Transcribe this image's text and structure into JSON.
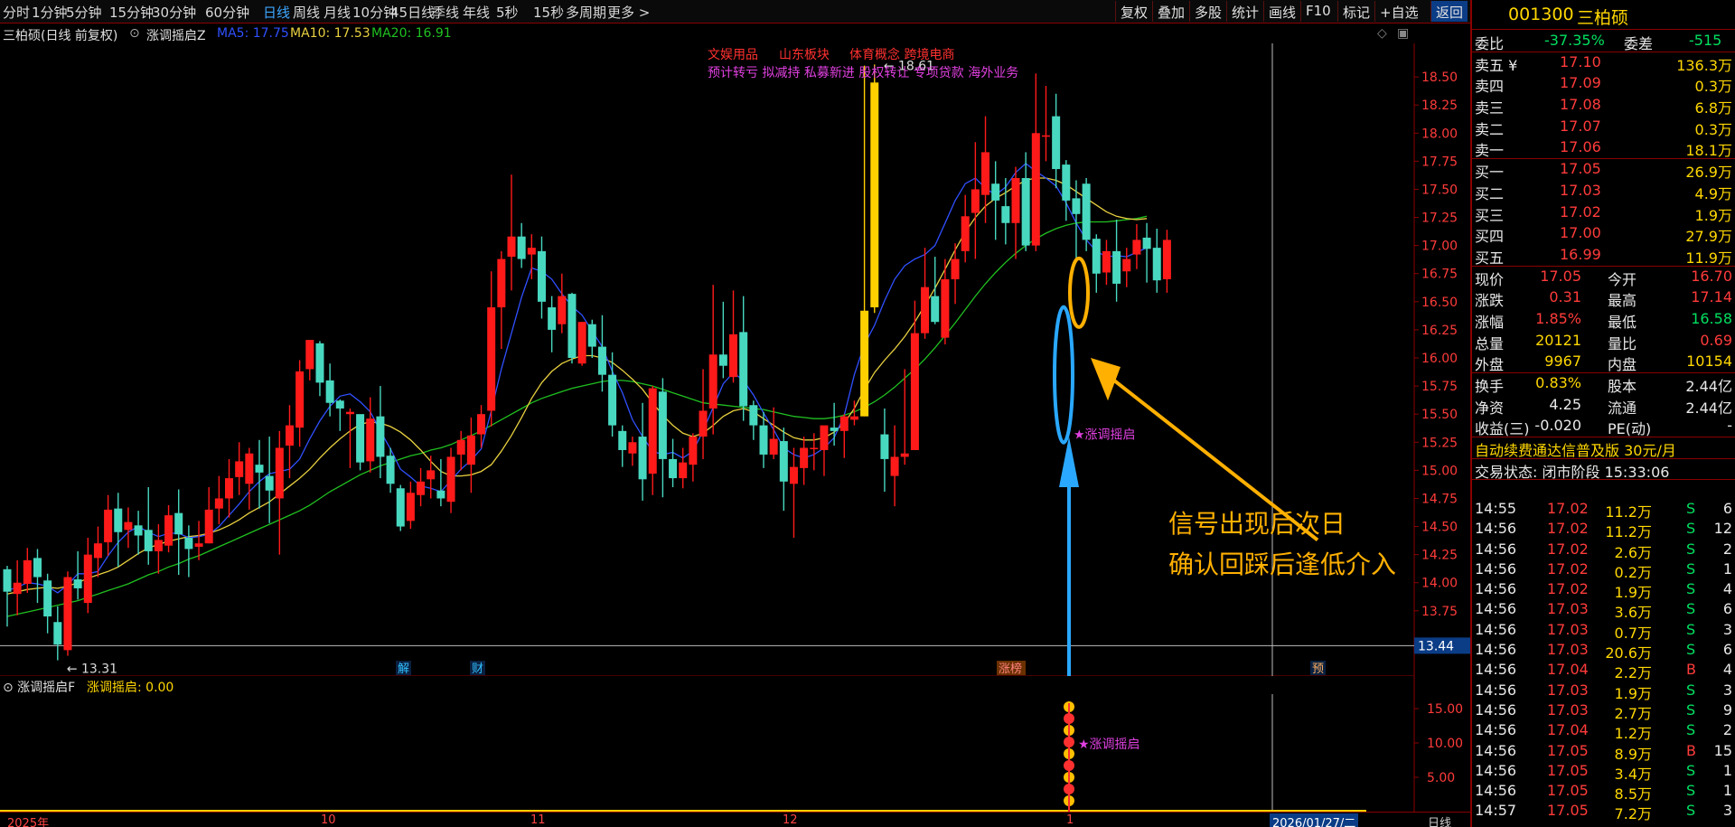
{
  "periods": [
    "分时",
    "1分钟",
    "5分钟",
    "15分钟",
    "30分钟",
    "60分钟",
    "日线",
    "周线",
    "月线",
    "10分钟",
    "45日线",
    "季线",
    "年线",
    "5秒",
    "15秒",
    "多周期",
    "更多 >"
  ],
  "active_period": "日线",
  "right_buttons": [
    "复权",
    "叠加",
    "多股",
    "统计",
    "画线",
    "F10",
    "标记",
    "+自选",
    "返回"
  ],
  "stock": {
    "code": "001300",
    "name": "三柏硕"
  },
  "info": {
    "title": "三柏硕(日线 前复权)",
    "indicator": "涨调摇启Z",
    "ma5": "MA5: 17.75",
    "ma10": "MA10: 17.53",
    "ma20": "MA20: 16.91"
  },
  "concepts": {
    "line1": [
      "文娱用品",
      "山东板块",
      "体育概念 跨境电商"
    ],
    "line2": "预计转亏 拟减持 私募新进 股权转让 专项贷款 海外业务"
  },
  "annotation": {
    "signal_label": "★涨调摇启",
    "note_line1": "信号出现后次日",
    "note_line2": "确认回踩后逢低介入",
    "max_label": "18.61",
    "min_label": "13.31",
    "crosshair_price": "13.44"
  },
  "event_markers": [
    "解",
    "财",
    "涨榜",
    "预"
  ],
  "sub": {
    "title": "涨调摇启F",
    "value": "涨调摇启: 0.00",
    "ticks": [
      "15.00",
      "10.00",
      "5.00"
    ],
    "signal": "★涨调摇启"
  },
  "x_labels": [
    "2025年",
    "10",
    "11",
    "12",
    "1",
    "2026/01/27/二",
    "日线"
  ],
  "quote": {
    "webi": {
      "label": "委比",
      "value": "-37.35%",
      "label2": "委差",
      "value2": "-515"
    },
    "asks": [
      [
        "卖五 ¥",
        "17.10",
        "136.3万"
      ],
      [
        "卖四",
        "17.09",
        "0.3万"
      ],
      [
        "卖三",
        "17.08",
        "6.8万"
      ],
      [
        "卖二",
        "17.07",
        "0.3万"
      ],
      [
        "卖一",
        "17.06",
        "18.1万"
      ]
    ],
    "bids": [
      [
        "买一",
        "17.05",
        "26.9万"
      ],
      [
        "买二",
        "17.03",
        "4.9万"
      ],
      [
        "买三",
        "17.02",
        "1.9万"
      ],
      [
        "买四",
        "17.00",
        "27.9万"
      ],
      [
        "买五",
        "16.99",
        "11.9万"
      ]
    ],
    "stats": [
      [
        "现价",
        "17.05",
        "今开",
        "16.70"
      ],
      [
        "涨跌",
        "0.31",
        "最高",
        "17.14"
      ],
      [
        "涨幅",
        "1.85%",
        "最低",
        "16.58"
      ],
      [
        "总量",
        "20121",
        "量比",
        "0.69"
      ],
      [
        "外盘",
        "9967",
        "内盘",
        "10154"
      ]
    ],
    "stats2": [
      [
        "换手",
        "0.83%",
        "股本",
        "2.44亿"
      ],
      [
        "净资",
        "4.25",
        "流通",
        "2.44亿"
      ],
      [
        "收益(三)",
        "-0.020",
        "PE(动)",
        "-"
      ]
    ],
    "promo": "自动续费通达信普及版  30元/月",
    "status": "交易状态: 闭市阶段 15:33:06"
  },
  "ticks": [
    [
      "14:55",
      "17.02",
      "11.2万",
      "S",
      "6"
    ],
    [
      "14:56",
      "17.02",
      "11.2万",
      "S",
      "12"
    ],
    [
      "14:56",
      "17.02",
      "2.6万",
      "S",
      "2"
    ],
    [
      "14:56",
      "17.02",
      "0.2万",
      "S",
      "1"
    ],
    [
      "14:56",
      "17.02",
      "1.9万",
      "S",
      "4"
    ],
    [
      "14:56",
      "17.03",
      "3.6万",
      "S",
      "6"
    ],
    [
      "14:56",
      "17.03",
      "0.7万",
      "S",
      "3"
    ],
    [
      "14:56",
      "17.03",
      "20.6万",
      "S",
      "6"
    ],
    [
      "14:56",
      "17.04",
      "2.2万",
      "B",
      "4"
    ],
    [
      "14:56",
      "17.03",
      "1.9万",
      "S",
      "3"
    ],
    [
      "14:56",
      "17.03",
      "2.7万",
      "S",
      "9"
    ],
    [
      "14:56",
      "17.04",
      "1.2万",
      "S",
      "2"
    ],
    [
      "14:56",
      "17.05",
      "8.9万",
      "B",
      "15"
    ],
    [
      "14:56",
      "17.05",
      "3.4万",
      "S",
      "1"
    ],
    [
      "14:56",
      "17.05",
      "8.5万",
      "S",
      "1"
    ],
    [
      "14:57",
      "17.05",
      "7.2万",
      "S",
      "3"
    ]
  ],
  "chart_data": {
    "type": "candlestick",
    "title": "三柏硕(日线 前复权)",
    "ylim": [
      13.25,
      18.75
    ],
    "y_ticks": [
      18.5,
      18.25,
      18.0,
      17.75,
      17.5,
      17.25,
      17.0,
      16.75,
      16.5,
      16.25,
      16.0,
      15.75,
      15.5,
      15.25,
      15.0,
      14.75,
      14.5,
      14.25,
      14.0,
      13.75
    ],
    "colors": {
      "up": "#ff1a1a",
      "down": "#48d8c0",
      "ma5": "#3050ff",
      "ma10": "#e8d040",
      "ma20": "#20c020"
    },
    "ohlc": [
      [
        14.12,
        14.15,
        13.92,
        13.61
      ],
      [
        13.9,
        14.2,
        14.0,
        13.71
      ],
      [
        13.99,
        14.31,
        14.2,
        13.91
      ],
      [
        14.22,
        14.3,
        14.05,
        13.82
      ],
      [
        14.02,
        14.08,
        13.7,
        13.55
      ],
      [
        13.65,
        13.79,
        13.45,
        13.31
      ],
      [
        13.4,
        14.1,
        14.05,
        13.35
      ],
      [
        14.03,
        14.28,
        13.95,
        13.85
      ],
      [
        13.82,
        14.4,
        14.25,
        13.73
      ],
      [
        14.22,
        14.5,
        14.35,
        14.05
      ],
      [
        14.36,
        14.78,
        14.65,
        14.24
      ],
      [
        14.66,
        14.8,
        14.45,
        14.14
      ],
      [
        14.47,
        14.67,
        14.54,
        14.31
      ],
      [
        14.51,
        14.64,
        14.42,
        14.25
      ],
      [
        14.47,
        14.85,
        14.28,
        14.16
      ],
      [
        14.28,
        14.52,
        14.38,
        14.08
      ],
      [
        14.33,
        14.69,
        14.6,
        14.27
      ],
      [
        14.62,
        14.83,
        14.43,
        14.07
      ],
      [
        14.4,
        14.51,
        14.3,
        14.05
      ],
      [
        14.32,
        14.55,
        14.35,
        14.2
      ],
      [
        14.35,
        14.85,
        14.65,
        14.35
      ],
      [
        14.66,
        14.95,
        14.75,
        14.52
      ],
      [
        14.75,
        15.1,
        14.93,
        14.58
      ],
      [
        14.94,
        15.25,
        15.08,
        14.78
      ],
      [
        14.88,
        15.2,
        15.15,
        14.65
      ],
      [
        15.05,
        15.27,
        14.98,
        14.66
      ],
      [
        14.95,
        15.3,
        14.82,
        14.53
      ],
      [
        14.75,
        15.35,
        15.2,
        14.25
      ],
      [
        15.22,
        15.58,
        15.4,
        14.93
      ],
      [
        15.38,
        15.98,
        15.88,
        15.21
      ],
      [
        15.9,
        16.12,
        16.16,
        15.8
      ],
      [
        16.13,
        16.15,
        15.78,
        15.66
      ],
      [
        15.8,
        15.95,
        15.6,
        15.48
      ],
      [
        15.62,
        15.63,
        15.55,
        15.35
      ],
      [
        15.5,
        15.55,
        15.52,
        15.02
      ],
      [
        15.5,
        15.4,
        15.07,
        15.0
      ],
      [
        15.08,
        15.65,
        15.46,
        14.98
      ],
      [
        15.48,
        15.75,
        15.12,
        14.93
      ],
      [
        15.13,
        15.2,
        14.88,
        14.8
      ],
      [
        14.84,
        14.87,
        14.5,
        14.46
      ],
      [
        14.55,
        14.9,
        14.8,
        14.48
      ],
      [
        14.78,
        15.02,
        14.9,
        14.68
      ],
      [
        14.92,
        15.13,
        15.0,
        14.75
      ],
      [
        14.82,
        15.1,
        14.75,
        14.68
      ],
      [
        14.72,
        15.2,
        15.12,
        14.62
      ],
      [
        15.14,
        15.35,
        15.27,
        15.0
      ],
      [
        15.05,
        15.47,
        15.31,
        14.8
      ],
      [
        15.32,
        15.58,
        15.5,
        15.2
      ],
      [
        15.53,
        16.77,
        16.45,
        15.39
      ],
      [
        16.45,
        16.95,
        16.88,
        16.08
      ],
      [
        16.9,
        17.63,
        17.08,
        16.6
      ],
      [
        17.08,
        17.2,
        16.88,
        16.8
      ],
      [
        16.92,
        17.1,
        16.98,
        16.7
      ],
      [
        16.95,
        17.08,
        16.5,
        16.35
      ],
      [
        16.45,
        16.55,
        16.25,
        16.05
      ],
      [
        16.3,
        16.75,
        16.55,
        16.22
      ],
      [
        16.57,
        16.58,
        16.0,
        15.95
      ],
      [
        15.95,
        16.32,
        16.32,
        15.93
      ],
      [
        16.3,
        16.34,
        16.1,
        16.0
      ],
      [
        16.1,
        16.38,
        15.85,
        15.7
      ],
      [
        15.85,
        16.05,
        15.4,
        15.3
      ],
      [
        15.35,
        15.4,
        15.18,
        15.03
      ],
      [
        15.15,
        15.3,
        15.25,
        15.04
      ],
      [
        15.3,
        15.6,
        14.92,
        14.73
      ],
      [
        14.97,
        15.75,
        15.73,
        14.78
      ],
      [
        15.7,
        15.82,
        15.1,
        14.76
      ],
      [
        15.1,
        15.28,
        14.93,
        14.85
      ],
      [
        14.93,
        15.2,
        15.07,
        14.84
      ],
      [
        15.05,
        15.33,
        15.3,
        14.9
      ],
      [
        15.3,
        15.9,
        15.53,
        15.1
      ],
      [
        15.55,
        16.65,
        16.03,
        15.32
      ],
      [
        16.03,
        16.5,
        15.93,
        15.82
      ],
      [
        15.83,
        16.6,
        16.21,
        15.78
      ],
      [
        16.23,
        16.55,
        15.57,
        15.44
      ],
      [
        15.58,
        15.62,
        15.4,
        15.27
      ],
      [
        15.4,
        15.52,
        15.14,
        15.02
      ],
      [
        15.14,
        15.56,
        15.28,
        15.1
      ],
      [
        15.26,
        15.38,
        14.9,
        14.64
      ],
      [
        14.88,
        15.2,
        15.03,
        14.4
      ],
      [
        15.02,
        15.3,
        15.2,
        14.87
      ],
      [
        15.2,
        15.33,
        15.2,
        15.0
      ],
      [
        15.18,
        15.28,
        15.4,
        14.95
      ],
      [
        15.38,
        15.6,
        15.35,
        15.22
      ],
      [
        15.35,
        15.5,
        15.48,
        15.11
      ],
      [
        15.45,
        15.62,
        15.48,
        15.4
      ],
      [
        15.48,
        18.6,
        16.42,
        15.48
      ],
      [
        16.45,
        18.61,
        18.45,
        16.4
      ],
      [
        15.32,
        15.55,
        15.1,
        14.81
      ],
      [
        14.95,
        15.4,
        15.12,
        14.68
      ],
      [
        15.12,
        15.9,
        15.15,
        15.05
      ],
      [
        15.18,
        16.51,
        16.22,
        15.2
      ],
      [
        16.22,
        16.98,
        16.63,
        16.17
      ],
      [
        16.55,
        16.9,
        16.32,
        16.3
      ],
      [
        16.18,
        16.88,
        16.7,
        16.12
      ],
      [
        16.7,
        17.02,
        16.88,
        16.48
      ],
      [
        16.95,
        17.45,
        17.26,
        16.85
      ],
      [
        17.29,
        17.92,
        17.5,
        16.88
      ],
      [
        17.45,
        18.15,
        17.83,
        17.2
      ],
      [
        17.55,
        17.75,
        17.4,
        17.05
      ],
      [
        17.35,
        17.6,
        17.2,
        17.01
      ],
      [
        17.2,
        17.7,
        17.6,
        16.88
      ],
      [
        17.6,
        17.83,
        17.0,
        16.95
      ],
      [
        17.0,
        18.53,
        18.0,
        16.95
      ],
      [
        17.98,
        18.42,
        17.98,
        17.75
      ],
      [
        18.15,
        18.35,
        17.68,
        17.51
      ],
      [
        17.72,
        17.76,
        17.4,
        17.22
      ],
      [
        17.42,
        17.58,
        17.28,
        16.86
      ],
      [
        17.55,
        17.6,
        17.05,
        16.95
      ],
      [
        17.06,
        17.1,
        16.75,
        16.58
      ],
      [
        16.76,
        17.05,
        16.95,
        16.65
      ],
      [
        16.95,
        17.23,
        16.66,
        16.5
      ],
      [
        16.77,
        16.98,
        16.88,
        16.63
      ],
      [
        16.92,
        17.19,
        17.05,
        16.79
      ],
      [
        17.07,
        17.2,
        16.97,
        16.67
      ],
      [
        16.98,
        17.15,
        16.69,
        16.58
      ],
      [
        16.7,
        17.14,
        17.05,
        16.58
      ]
    ],
    "ma5": [
      13.93,
      13.96,
      14.0,
      13.99,
      13.97,
      13.91,
      13.98,
      14.08,
      14.08,
      14.1,
      14.24,
      14.36,
      14.45,
      14.5,
      14.45,
      14.41,
      14.44,
      14.44,
      14.4,
      14.41,
      14.43,
      14.5,
      14.6,
      14.7,
      14.81,
      14.9,
      14.97,
      14.99,
      15.01,
      15.1,
      15.28,
      15.44,
      15.57,
      15.66,
      15.68,
      15.61,
      15.52,
      15.35,
      15.19,
      15.01,
      14.94,
      14.86,
      14.84,
      14.81,
      14.91,
      15.01,
      15.09,
      15.19,
      15.53,
      15.9,
      16.22,
      16.54,
      16.8,
      16.77,
      16.7,
      16.57,
      16.46,
      16.38,
      16.24,
      16.1,
      15.88,
      15.69,
      15.45,
      15.3,
      15.17,
      15.14,
      15.16,
      15.11,
      15.17,
      15.35,
      15.56,
      15.77,
      15.87,
      15.8,
      15.67,
      15.51,
      15.36,
      15.2,
      15.14,
      15.11,
      15.14,
      15.2,
      15.29,
      15.49,
      15.85,
      16.12,
      16.29,
      16.51,
      16.7,
      16.82,
      16.88,
      16.92,
      17.0,
      17.2,
      17.4,
      17.55,
      17.6,
      17.51,
      17.45,
      17.52,
      17.65,
      17.73,
      17.66,
      17.6,
      17.53,
      17.38,
      17.2,
      17.05,
      16.95,
      16.9,
      16.91,
      16.9,
      16.94,
      16.98
    ],
    "ma10": [
      13.9,
      13.92,
      13.94,
      13.95,
      13.96,
      13.95,
      13.97,
      14.0,
      14.04,
      14.07,
      14.1,
      14.14,
      14.2,
      14.26,
      14.31,
      14.34,
      14.37,
      14.39,
      14.41,
      14.42,
      14.44,
      14.47,
      14.51,
      14.56,
      14.62,
      14.67,
      14.72,
      14.79,
      14.86,
      14.93,
      15.01,
      15.11,
      15.2,
      15.28,
      15.35,
      15.41,
      15.43,
      15.42,
      15.39,
      15.34,
      15.27,
      15.18,
      15.08,
      14.99,
      14.95,
      14.95,
      14.96,
      14.99,
      15.05,
      15.17,
      15.31,
      15.47,
      15.64,
      15.78,
      15.88,
      15.95,
      15.99,
      16.02,
      16.02,
      16.0,
      15.96,
      15.89,
      15.81,
      15.72,
      15.6,
      15.49,
      15.4,
      15.33,
      15.3,
      15.33,
      15.4,
      15.48,
      15.53,
      15.55,
      15.52,
      15.46,
      15.4,
      15.34,
      15.29,
      15.27,
      15.27,
      15.29,
      15.34,
      15.42,
      15.55,
      15.72,
      15.87,
      15.98,
      16.08,
      16.19,
      16.32,
      16.47,
      16.62,
      16.79,
      16.96,
      17.12,
      17.25,
      17.35,
      17.42,
      17.47,
      17.53,
      17.58,
      17.6,
      17.6,
      17.58,
      17.54,
      17.48,
      17.42,
      17.36,
      17.3,
      17.26,
      17.24,
      17.23,
      17.24
    ],
    "ma20": [
      13.7,
      13.72,
      13.74,
      13.76,
      13.78,
      13.8,
      13.82,
      13.84,
      13.87,
      13.9,
      13.93,
      13.96,
      13.99,
      14.03,
      14.07,
      14.1,
      14.14,
      14.17,
      14.21,
      14.24,
      14.28,
      14.32,
      14.36,
      14.4,
      14.44,
      14.48,
      14.52,
      14.56,
      14.6,
      14.64,
      14.69,
      14.75,
      14.81,
      14.86,
      14.91,
      14.96,
      15.0,
      15.04,
      15.07,
      15.1,
      15.13,
      15.15,
      15.18,
      15.2,
      15.23,
      15.27,
      15.31,
      15.35,
      15.4,
      15.45,
      15.5,
      15.55,
      15.6,
      15.64,
      15.67,
      15.7,
      15.73,
      15.75,
      15.77,
      15.79,
      15.8,
      15.8,
      15.79,
      15.77,
      15.75,
      15.72,
      15.69,
      15.66,
      15.63,
      15.6,
      15.59,
      15.58,
      15.57,
      15.56,
      15.55,
      15.54,
      15.52,
      15.5,
      15.48,
      15.47,
      15.46,
      15.46,
      15.47,
      15.49,
      15.52,
      15.56,
      15.61,
      15.67,
      15.74,
      15.82,
      15.9,
      15.99,
      16.09,
      16.2,
      16.31,
      16.43,
      16.55,
      16.66,
      16.76,
      16.85,
      16.93,
      17.0,
      17.06,
      17.11,
      17.15,
      17.18,
      17.2,
      17.21,
      17.21,
      17.21,
      17.22,
      17.23,
      17.24,
      17.26
    ],
    "sub_values": [
      15.0,
      10.0,
      5.0
    ]
  }
}
